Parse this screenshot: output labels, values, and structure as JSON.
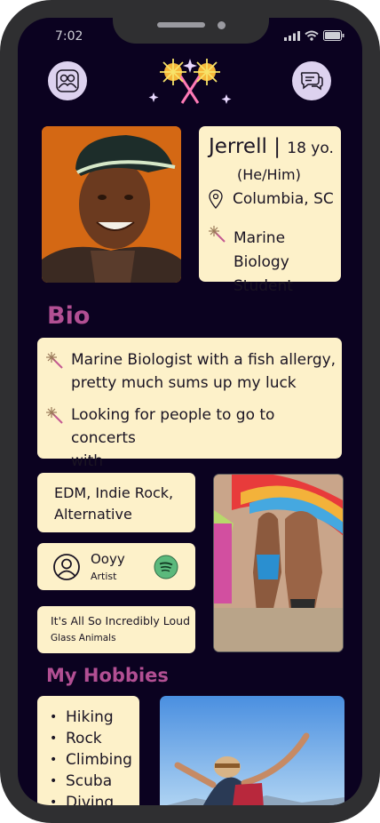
{
  "status_bar": {
    "time": "7:02"
  },
  "profile": {
    "name": "Jerrell",
    "separator": "|",
    "age": "18 yo.",
    "pronouns": "(He/Him)",
    "location": "Columbia, SC",
    "occupation_line1": "Marine Biology",
    "occupation_line2": "Student"
  },
  "bio": {
    "heading": "Bio",
    "items": [
      {
        "line1": "Marine Biologist with a fish allergy,",
        "line2": "pretty much sums up my luck"
      },
      {
        "line1": "Looking for people to go to concerts",
        "line2": "with"
      }
    ]
  },
  "music": {
    "genres_line1": "EDM, Indie Rock,",
    "genres_line2": "Alternative",
    "artist_name": "Ooyy",
    "artist_type": "Artist",
    "song_title": "It's All So Incredibly Loud",
    "song_artist": "Glass Animals"
  },
  "hobbies": {
    "heading": "My Hobbies",
    "items": [
      "Hiking",
      "Rock",
      "Climbing",
      "Scuba",
      "Diving"
    ]
  },
  "icons": {
    "left_button": "friends-icon",
    "right_button": "chat-icon",
    "logo": "sparkler-logo",
    "location": "location-pin-icon",
    "occupation": "sparkler-icon",
    "bullet": "sparkler-icon",
    "artist": "user-circle-icon",
    "streaming": "spotify-icon"
  },
  "colors": {
    "background": "#0b0220",
    "card": "#fdf1c9",
    "heading": "#b24f93",
    "button": "#ddd2ef",
    "spotify": "#5bb97c"
  }
}
